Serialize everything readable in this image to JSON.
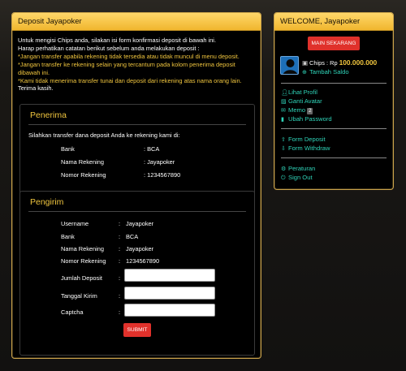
{
  "main": {
    "header": "Deposit Jayapoker",
    "intro": [
      {
        "text": "Untuk mengisi Chips anda, silakan isi form konfirmasi deposit di bawah ini.",
        "color": "white"
      },
      {
        "text": "Harap perhatikan catatan berikut sebelum anda melakukan deposit :",
        "color": "white"
      },
      {
        "text": "*Jangan transfer apabila rekening tidak tersedia atau tidak muncul di menu deposit.",
        "color": "yellow"
      },
      {
        "text": "*Jangan transfer ke rekening selain yang tercantum pada kolom penerima deposit",
        "color": "yellow"
      },
      {
        "text": "dibawah ini.",
        "color": "yellow"
      },
      {
        "text": "*Kami tidak menerima transfer tunai dan deposit dari rekening atas nama orang lain.",
        "color": "yellow"
      },
      {
        "text": "Terima kasih.",
        "color": "white"
      }
    ],
    "penerima": {
      "title": "Penerima",
      "instruction": "Silahkan transfer dana deposit Anda ke rekening kami di:",
      "rows": [
        {
          "label": "Bank",
          "value": ": BCA"
        },
        {
          "label": "Nama Rekening",
          "value": ": Jayapoker"
        },
        {
          "label": "Nomor Rekening",
          "value": ": 1234567890"
        }
      ]
    },
    "pengirim": {
      "title": "Pengirim",
      "rows": [
        {
          "label": "Username",
          "value": "Jayapoker"
        },
        {
          "label": "Bank",
          "value": "BCA"
        },
        {
          "label": "Nama Rekening",
          "value": "Jayapoker"
        },
        {
          "label": "Nomor Rekening",
          "value": "1234567890"
        }
      ],
      "inputs": [
        {
          "label": "Jumlah Deposit",
          "value": ""
        },
        {
          "label": "Tanggal Kirim",
          "value": ""
        },
        {
          "label": "Captcha",
          "value": ""
        }
      ],
      "colon": ":",
      "submit_label": "SUBMIT"
    }
  },
  "side": {
    "header": "WELCOME, Jayapoker",
    "play_label": "MAIN SEKARANG",
    "chips_label": "Chips : Rp ",
    "chips_value": "100.000.000",
    "topup_label": "Tambah Saldo",
    "links_account": [
      {
        "label": "Lihat Profil",
        "icon": "user-icon"
      },
      {
        "label": "Ganti Avatar",
        "icon": "image-icon"
      },
      {
        "label": "Memo",
        "icon": "envelope-icon",
        "badge": "2"
      },
      {
        "label": "Ubah Password",
        "icon": "lock-icon"
      }
    ],
    "links_form": [
      {
        "label": "Form Deposit",
        "icon": "upload-icon"
      },
      {
        "label": "Form Withdraw",
        "icon": "download-icon"
      }
    ],
    "links_other": [
      {
        "label": "Peraturan",
        "icon": "gear-icon"
      },
      {
        "label": "Sign Out",
        "icon": "sign-out-icon"
      }
    ]
  },
  "colors": {
    "accent": "#f0c53e",
    "link": "#2fd3b8",
    "button": "#e0312b",
    "header": "#f0b62e"
  }
}
